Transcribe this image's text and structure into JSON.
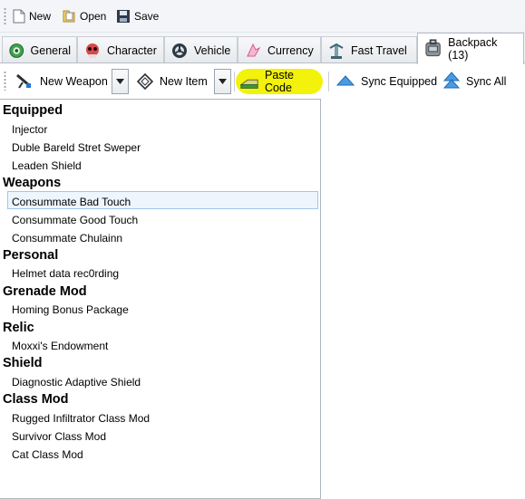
{
  "toolbar": {
    "new_label": "New",
    "open_label": "Open",
    "save_label": "Save"
  },
  "tabs": [
    {
      "label": "General",
      "icon": "gear-icon"
    },
    {
      "label": "Character",
      "icon": "skull-icon"
    },
    {
      "label": "Vehicle",
      "icon": "wheel-icon"
    },
    {
      "label": "Currency",
      "icon": "currency-icon"
    },
    {
      "label": "Fast Travel",
      "icon": "fast-travel-icon"
    },
    {
      "label": "Backpack (13)",
      "icon": "backpack-icon",
      "active": true
    }
  ],
  "backpack_toolbar": {
    "new_weapon_label": "New Weapon",
    "new_item_label": "New Item",
    "paste_code_label": "Paste Code",
    "sync_equipped_label": "Sync Equipped",
    "sync_all_label": "Sync All",
    "highlight_color": "#f2f20a"
  },
  "inventory": [
    {
      "category": "Equipped",
      "items": [
        "Injector",
        "Duble Bareld Stret Sweper",
        "Leaden Shield"
      ]
    },
    {
      "category": "Weapons",
      "items": [
        "Consummate Bad Touch",
        "Consummate Good Touch",
        "Consummate Chulainn"
      ]
    },
    {
      "category": "Personal",
      "items": [
        "Helmet data rec0rding"
      ]
    },
    {
      "category": "Grenade Mod",
      "items": [
        "Homing Bonus Package"
      ]
    },
    {
      "category": "Relic",
      "items": [
        "Moxxi's Endowment"
      ]
    },
    {
      "category": "Shield",
      "items": [
        "Diagnostic Adaptive Shield"
      ]
    },
    {
      "category": "Class Mod",
      "items": [
        "Rugged Infiltrator Class Mod",
        "Survivor Class Mod",
        "Cat Class Mod"
      ]
    }
  ],
  "selected_item": "Consummate Bad Touch"
}
